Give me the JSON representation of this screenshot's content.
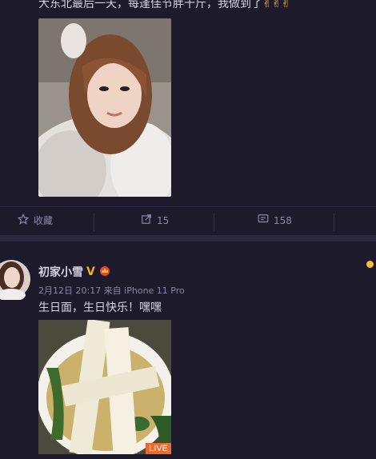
{
  "post1": {
    "text": "大东北最后一天，每逢佳节胖十斤，我做到了",
    "emoji": "✌✌✌"
  },
  "actions": {
    "favorite_label": "收藏",
    "repost_count": "15",
    "comment_count": "158"
  },
  "post2": {
    "author": "初家小雪",
    "verified_badge": "V",
    "meta": "2月12日 20:17 来自 iPhone 11 Pro",
    "text": "生日面，生日快乐！嘿嘿",
    "live_badge": "LIVE"
  },
  "colors": {
    "background": "#1d1a2c",
    "divider": "#2b2840",
    "live_badge": "#e86b2f",
    "verified": "#f5b31a"
  }
}
